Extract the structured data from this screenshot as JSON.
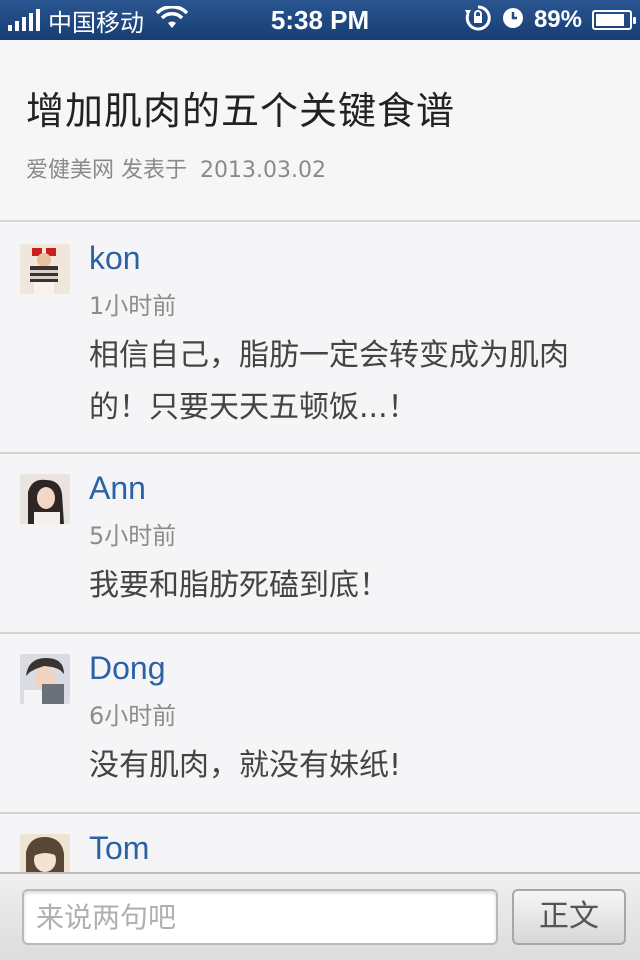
{
  "status_bar": {
    "carrier": "中国移动",
    "time": "5:38 PM",
    "battery_percent": "89%",
    "battery_level": 0.89,
    "icons": [
      "signal-icon",
      "wifi-icon",
      "rotation-lock-icon",
      "alarm-icon",
      "battery-icon"
    ]
  },
  "article": {
    "title": "增加肌肉的五个关键食谱",
    "source": "爱健美网",
    "posted_label": "发表于",
    "date": "2013.03.02"
  },
  "comments": [
    {
      "name": "kon",
      "time": "1小时前",
      "text": "相信自己，脂肪一定会转变成为肌肉的！只要天天五顿饭...！"
    },
    {
      "name": "Ann",
      "time": "5小时前",
      "text": "我要和脂肪死磕到底！"
    },
    {
      "name": "Dong",
      "time": "6小时前",
      "text": "没有肌肉，就没有妹纸!"
    },
    {
      "name": "Tom",
      "time": "",
      "text": ""
    }
  ],
  "input_bar": {
    "placeholder": "来说两句吧",
    "value": "",
    "button_label": "正文"
  },
  "colors": {
    "status_bar_bg": "#1f4a83",
    "name_link": "#2b62a6"
  }
}
